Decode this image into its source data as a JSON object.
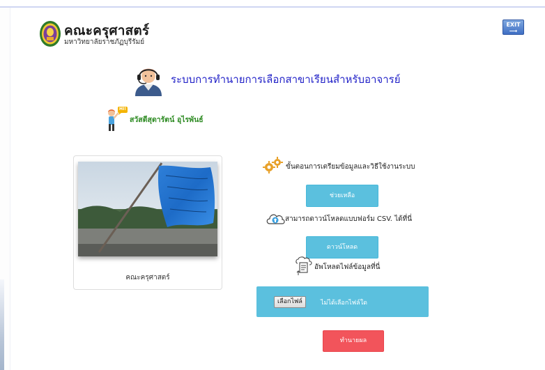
{
  "header": {
    "title": "คณะครุศาสตร์",
    "subtitle": "มหาวิทยาลัยราชภัฏบุรีรัมย์",
    "exit_label": "EXIT"
  },
  "system": {
    "title": "ระบบการทำนายการเลือกสาขาเรียนสำหรับอาจารย์"
  },
  "user": {
    "greeting": "สวัสดีสุดารัตน์ อุไรพันธ์",
    "hi_badge": "HI!"
  },
  "card": {
    "caption": "คณะครุศาสตร์"
  },
  "steps": {
    "text": "ขั้นตอนการเตรียมข้อมูลและวิธีใช้งานระบบ",
    "help_label": "ช่วยเหลือ"
  },
  "download": {
    "text": "สามารถดาวน์โหลดแบบฟอร์ม CSV. ได้ที่นี่",
    "button_label": "ดาวน์โหลด"
  },
  "upload": {
    "text": "อัพโหลดไฟล์ข้อมูลที่นี่",
    "choose_label": "เลือกไฟล์",
    "status": "ไม่ได้เลือกไฟล์ใด"
  },
  "predict": {
    "button_label": "ทำนายผล"
  },
  "colors": {
    "title_blue": "#2323c8",
    "greeting_green": "#2e8b23",
    "info_button": "#5bc0de",
    "danger_button": "#f2545b"
  },
  "icons": {
    "logo": "faculty-seal-icon",
    "exit": "exit-icon",
    "agent": "call-center-agent-icon",
    "greeting": "waving-person-icon",
    "steps": "gears-icon",
    "download": "cloud-upload-icon",
    "upload": "document-upload-icon"
  }
}
